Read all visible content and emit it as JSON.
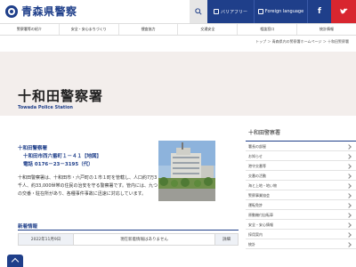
{
  "header": {
    "logo_text": "青森県警察",
    "barrier_free_label": "バリアフリー",
    "language_label": "Foreign language",
    "facebook_label": "f",
    "twitter_label": "t"
  },
  "nav": {
    "items": [
      "警察署等の紹介",
      "安全・安心まちづくり",
      "捜査協力",
      "交通安全",
      "相談窓口",
      "統計情報"
    ]
  },
  "breadcrumb": "トップ ＞ 青森県内の警察署ホームページ ＞ 十和田警察署",
  "page": {
    "title": "十和田警察署",
    "subtitle": "Towada Police Station"
  },
  "info": {
    "name": "十和田警察署",
    "address": "十和田市西六番町１－４１【地図】",
    "phone": "電話 0176－23－3195（代）"
  },
  "description": "十和田警察署は、十和田市・六戸町の１市１町を管轄し、人口約7万3千人、約33,000世帯の住民の治安を守る警察署です。管内には、九つの交番・駐在所があり、各種事件事故に迅速に対応しています。",
  "news": {
    "heading": "新着情報",
    "date": "2022年11月9日",
    "body": "現在新着情報はありません",
    "more": "詳細"
  },
  "sidebar": {
    "title": "十和田警察署",
    "items": [
      "署長の部屋",
      "お知らせ",
      "港守交番等",
      "交番の活動",
      "海と上地・地い物",
      "警察事業協会",
      "運転免許",
      "原動機付自転車",
      "安全・安心情報",
      "採用案内",
      "統計"
    ]
  },
  "colors": {
    "brand": "#1f3f8a",
    "twitter": "#d8262f",
    "band": "#f3eeec"
  }
}
